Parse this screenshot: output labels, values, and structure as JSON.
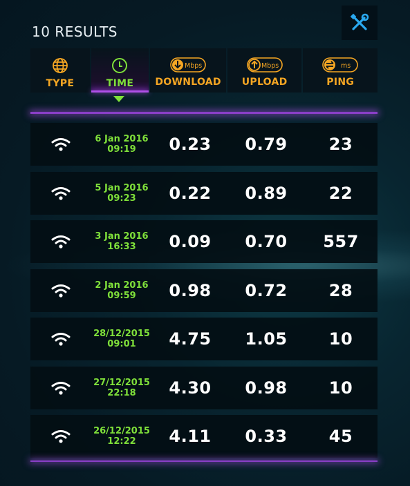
{
  "header": {
    "results_title": "10 RESULTS",
    "tools_icon": "tools-icon"
  },
  "columns": [
    {
      "key": "type",
      "label": "TYPE",
      "icon": "globe-icon",
      "active": false
    },
    {
      "key": "time",
      "label": "TIME",
      "icon": "clock-icon",
      "active": true
    },
    {
      "key": "download",
      "label": "DOWNLOAD",
      "icon": "download-icon",
      "unit": "Mbps",
      "active": false
    },
    {
      "key": "upload",
      "label": "UPLOAD",
      "icon": "upload-icon",
      "unit": "Mbps",
      "active": false
    },
    {
      "key": "ping",
      "label": "PING",
      "icon": "ping-icon",
      "unit": "ms",
      "active": false
    }
  ],
  "rows": [
    {
      "type_icon": "wifi-icon",
      "date": "6 Jan 2016",
      "time": "09:19",
      "download": "0.23",
      "upload": "0.79",
      "ping": "23"
    },
    {
      "type_icon": "wifi-icon",
      "date": "5 Jan 2016",
      "time": "09:23",
      "download": "0.22",
      "upload": "0.89",
      "ping": "22"
    },
    {
      "type_icon": "wifi-icon",
      "date": "3 Jan 2016",
      "time": "16:33",
      "download": "0.09",
      "upload": "0.70",
      "ping": "557"
    },
    {
      "type_icon": "wifi-icon",
      "date": "2 Jan 2016",
      "time": "09:59",
      "download": "0.98",
      "upload": "0.72",
      "ping": "28"
    },
    {
      "type_icon": "wifi-icon",
      "date": "28/12/2015",
      "time": "09:01",
      "download": "4.75",
      "upload": "1.05",
      "ping": "10"
    },
    {
      "type_icon": "wifi-icon",
      "date": "27/12/2015",
      "time": "22:18",
      "download": "4.30",
      "upload": "0.98",
      "ping": "10"
    },
    {
      "type_icon": "wifi-icon",
      "date": "26/12/2015",
      "time": "12:22",
      "download": "4.11",
      "upload": "0.33",
      "ping": "45"
    }
  ],
  "colors": {
    "accent_orange": "#f5a623",
    "accent_green": "#7fe03a",
    "accent_purple": "#b050e8",
    "tools_blue": "#2aa9f0"
  }
}
